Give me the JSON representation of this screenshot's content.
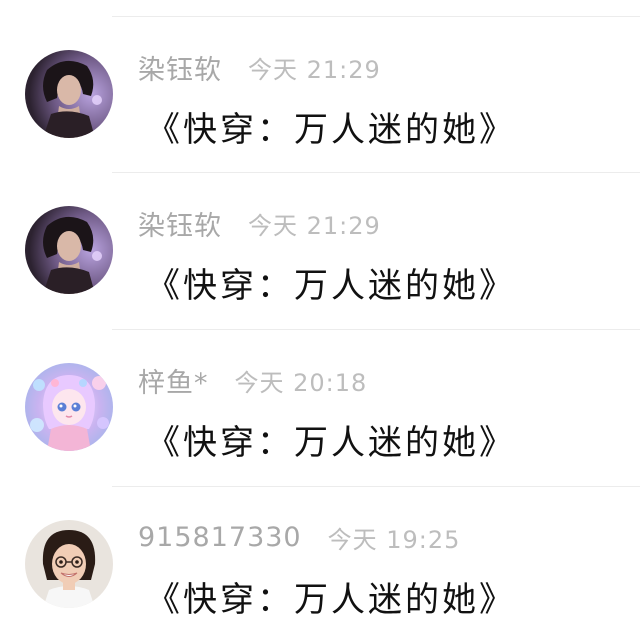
{
  "messages": [
    {
      "name": "染钰软",
      "time": "今天 21:29",
      "text": "《快穿：万人迷的她》",
      "avatar_icon": "woman-dark-hair-purple-light"
    },
    {
      "name": "染钰软",
      "time": "今天 21:29",
      "text": "《快穿：万人迷的她》",
      "avatar_icon": "woman-dark-hair-purple-light"
    },
    {
      "name": "梓鱼*",
      "time": "今天 20:18",
      "text": "《快穿：万人迷的她》",
      "avatar_icon": "anime-girl-pastel-bubbles"
    },
    {
      "name": "915817330",
      "time": "今天 19:25",
      "text": "《快穿：万人迷的她》",
      "avatar_icon": "smiling-girl-glasses"
    }
  ],
  "colors": {
    "name": "#a8a8a8",
    "time": "#bdbdbd",
    "text": "#111111",
    "divider": "#ececec"
  }
}
